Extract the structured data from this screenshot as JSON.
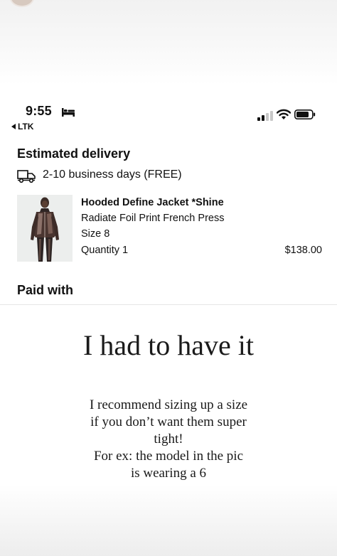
{
  "status_bar": {
    "time": "9:55",
    "back_app": "LTK"
  },
  "order": {
    "delivery_title": "Estimated delivery",
    "delivery_text": "2-10 business days (FREE)",
    "product": {
      "name": "Hooded Define Jacket *Shine",
      "color": "Radiate Foil Print French Press",
      "size": "Size 8",
      "quantity": "Quantity 1",
      "price": "$138.00"
    },
    "paid_title": "Paid with"
  },
  "story_text": {
    "headline": "I had to have it",
    "lines": [
      "I recommend sizing up a size",
      "if you don’t want them super",
      "tight!",
      "For ex: the model in the pic",
      "is wearing a 6"
    ]
  },
  "icons": [
    "bed-icon",
    "signal-icon",
    "wifi-icon",
    "battery-icon",
    "back-arrow-icon",
    "truck-icon"
  ]
}
